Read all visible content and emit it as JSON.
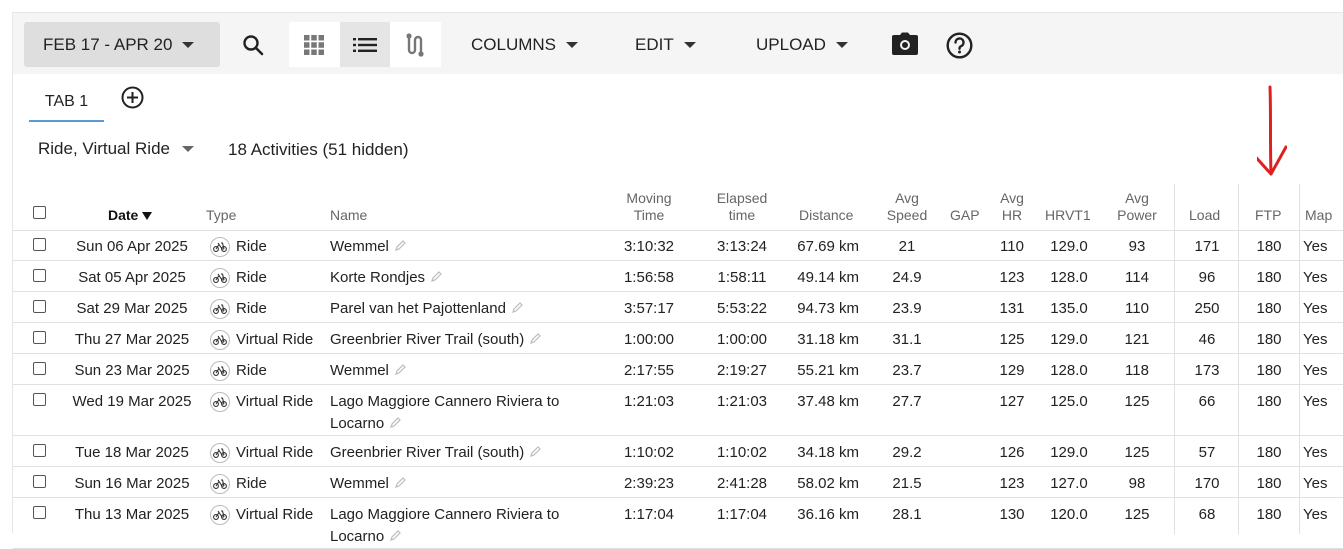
{
  "toolbar": {
    "date_range": "FEB 17 - APR 20",
    "columns_label": "COLUMNS",
    "edit_label": "EDIT",
    "upload_label": "UPLOAD"
  },
  "tabs": {
    "tab1_label": "TAB 1"
  },
  "filter": {
    "activity_types": "Ride, Virtual Ride",
    "count_text": "18 Activities (51 hidden)"
  },
  "columns": {
    "date": "Date",
    "type": "Type",
    "name": "Name",
    "moving_time_1": "Moving",
    "moving_time_2": "Time",
    "elapsed_time_1": "Elapsed",
    "elapsed_time_2": "time",
    "distance": "Distance",
    "avg_speed_1": "Avg",
    "avg_speed_2": "Speed",
    "gap": "GAP",
    "avg_hr_1": "Avg",
    "avg_hr_2": "HR",
    "hrvt1": "HRVT1",
    "avg_power_1": "Avg",
    "avg_power_2": "Power",
    "load": "Load",
    "ftp": "FTP",
    "map": "Map"
  },
  "rows": [
    {
      "date": "Sun 06 Apr 2025",
      "type": "Ride",
      "name": "Wemmel",
      "name2": "",
      "moving": "3:10:32",
      "elapsed": "3:13:24",
      "distance": "67.69 km",
      "speed": "21",
      "gap": "",
      "hr": "110",
      "hrvt1": "129.0",
      "power": "93",
      "load": "171",
      "ftp": "180",
      "map": "Yes"
    },
    {
      "date": "Sat 05 Apr 2025",
      "type": "Ride",
      "name": "Korte Rondjes",
      "name2": "",
      "moving": "1:56:58",
      "elapsed": "1:58:11",
      "distance": "49.14 km",
      "speed": "24.9",
      "gap": "",
      "hr": "123",
      "hrvt1": "128.0",
      "power": "114",
      "load": "96",
      "ftp": "180",
      "map": "Yes"
    },
    {
      "date": "Sat 29 Mar 2025",
      "type": "Ride",
      "name": "Parel van het Pajottenland",
      "name2": "",
      "moving": "3:57:17",
      "elapsed": "5:53:22",
      "distance": "94.73 km",
      "speed": "23.9",
      "gap": "",
      "hr": "131",
      "hrvt1": "135.0",
      "power": "110",
      "load": "250",
      "ftp": "180",
      "map": "Yes"
    },
    {
      "date": "Thu 27 Mar 2025",
      "type": "Virtual Ride",
      "name": "Greenbrier River Trail (south)",
      "name2": "",
      "moving": "1:00:00",
      "elapsed": "1:00:00",
      "distance": "31.18 km",
      "speed": "31.1",
      "gap": "",
      "hr": "125",
      "hrvt1": "129.0",
      "power": "121",
      "load": "46",
      "ftp": "180",
      "map": "Yes"
    },
    {
      "date": "Sun 23 Mar 2025",
      "type": "Ride",
      "name": "Wemmel",
      "name2": "",
      "moving": "2:17:55",
      "elapsed": "2:19:27",
      "distance": "55.21 km",
      "speed": "23.7",
      "gap": "",
      "hr": "129",
      "hrvt1": "128.0",
      "power": "118",
      "load": "173",
      "ftp": "180",
      "map": "Yes"
    },
    {
      "date": "Wed 19 Mar 2025",
      "type": "Virtual Ride",
      "name": "Lago Maggiore Cannero Riviera to",
      "name2": "Locarno",
      "moving": "1:21:03",
      "elapsed": "1:21:03",
      "distance": "37.48 km",
      "speed": "27.7",
      "gap": "",
      "hr": "127",
      "hrvt1": "125.0",
      "power": "125",
      "load": "66",
      "ftp": "180",
      "map": "Yes"
    },
    {
      "date": "Tue 18 Mar 2025",
      "type": "Virtual Ride",
      "name": "Greenbrier River Trail (south)",
      "name2": "",
      "moving": "1:10:02",
      "elapsed": "1:10:02",
      "distance": "34.18 km",
      "speed": "29.2",
      "gap": "",
      "hr": "126",
      "hrvt1": "129.0",
      "power": "125",
      "load": "57",
      "ftp": "180",
      "map": "Yes"
    },
    {
      "date": "Sun 16 Mar 2025",
      "type": "Ride",
      "name": "Wemmel",
      "name2": "",
      "moving": "2:39:23",
      "elapsed": "2:41:28",
      "distance": "58.02 km",
      "speed": "21.5",
      "gap": "",
      "hr": "123",
      "hrvt1": "127.0",
      "power": "98",
      "load": "170",
      "ftp": "180",
      "map": "Yes"
    },
    {
      "date": "Thu 13 Mar 2025",
      "type": "Virtual Ride",
      "name": "Lago Maggiore Cannero Riviera to",
      "name2": "Locarno",
      "moving": "1:17:04",
      "elapsed": "1:17:04",
      "distance": "36.16 km",
      "speed": "28.1",
      "gap": "",
      "hr": "130",
      "hrvt1": "120.0",
      "power": "125",
      "load": "68",
      "ftp": "180",
      "map": "Yes"
    }
  ],
  "colors": {
    "accent_tab": "#5b9bd5",
    "annotation_arrow": "#e02020"
  }
}
